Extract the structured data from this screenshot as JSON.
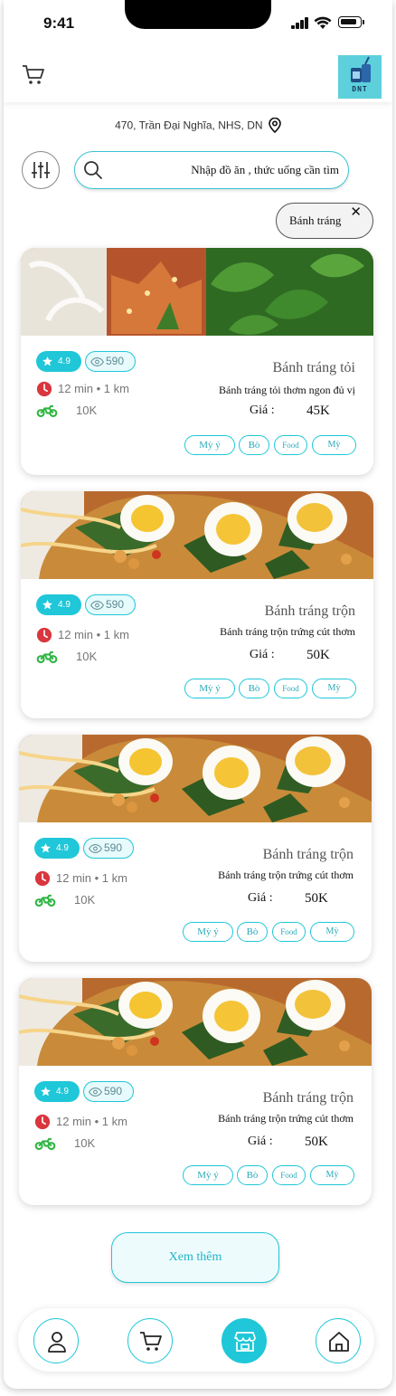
{
  "status_bar": {
    "time": "9:41"
  },
  "header": {
    "logo_text": "DNT"
  },
  "address": "470, Trần Đại Nghĩa, NHS, DN",
  "search": {
    "placeholder": "Nhập đồ ăn , thức uống cần tìm"
  },
  "active_filter": {
    "label": "Bánh tráng"
  },
  "colors": {
    "accent": "#1fc7d8",
    "ship_icon": "#2fb542",
    "time_icon": "#d9363e",
    "star": "#ffffff"
  },
  "cards": [
    {
      "name": "Bánh tráng tỏi",
      "desc": "Bánh tráng tỏi thơm ngon đủ vị",
      "rating": "4.9",
      "views": "590",
      "time": "12 min • 1 km",
      "ship_fee": "10K",
      "price_label": "Giá :",
      "price": "45K",
      "tags": [
        "Mỳ ý",
        "Bò",
        "Food",
        "Mỳ"
      ],
      "image": "banh-trang-toi"
    },
    {
      "name": "Bánh tráng trộn",
      "desc": "Bánh tráng trộn trứng cút thơm",
      "rating": "4.9",
      "views": "590",
      "time": "12 min • 1 km",
      "ship_fee": "10K",
      "price_label": "Giá :",
      "price": "50K",
      "tags": [
        "Mỳ ý",
        "Bò",
        "Food",
        "Mỳ"
      ],
      "image": "banh-trang-tron"
    },
    {
      "name": "Bánh tráng trộn",
      "desc": "Bánh tráng trộn trứng cút thơm",
      "rating": "4.9",
      "views": "590",
      "time": "12 min • 1 km",
      "ship_fee": "10K",
      "price_label": "Giá :",
      "price": "50K",
      "tags": [
        "Mỳ ý",
        "Bò",
        "Food",
        "Mỳ"
      ],
      "image": "banh-trang-tron"
    },
    {
      "name": "Bánh tráng trộn",
      "desc": "Bánh tráng trộn trứng cút thơm",
      "rating": "4.9",
      "views": "590",
      "time": "12 min • 1 km",
      "ship_fee": "10K",
      "price_label": "Giá :",
      "price": "50K",
      "tags": [
        "Mỳ ý",
        "Bò",
        "Food",
        "Mỳ"
      ],
      "image": "banh-trang-tron"
    }
  ],
  "load_more": "Xem thêm",
  "bottom_nav": [
    {
      "icon": "user-icon",
      "active": false
    },
    {
      "icon": "cart-icon",
      "active": false
    },
    {
      "icon": "store-icon",
      "active": true
    },
    {
      "icon": "home-icon",
      "active": false
    }
  ]
}
